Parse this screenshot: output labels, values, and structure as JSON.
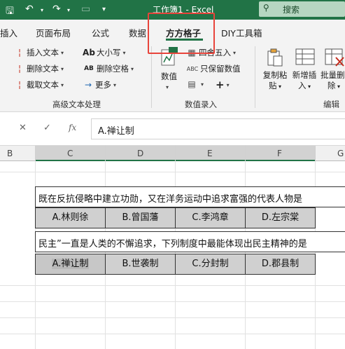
{
  "window": {
    "title": "工作簿1  -  Excel",
    "search_label": "搜索"
  },
  "tabs": [
    "插入",
    "页面布局",
    "公式",
    "数据",
    "方方格子",
    "DIY工具箱"
  ],
  "ribbon": {
    "text_group": {
      "items": [
        "插入文本",
        "删除文本",
        "截取文本"
      ],
      "items_right": [
        "大小写",
        "删除空格",
        "更多"
      ],
      "label": "高级文本处理"
    },
    "number_group": {
      "big_button": "数值",
      "items": [
        "四舍五入",
        "只保留数值"
      ],
      "label": "数值录入"
    },
    "edit_group": {
      "buttons": [
        {
          "line1": "复制粘",
          "line2": "贴"
        },
        {
          "line1": "新增插",
          "line2": "入"
        },
        {
          "line1": "批量删",
          "line2": "除"
        }
      ],
      "label": "编辑"
    }
  },
  "formula_bar": {
    "fx": "fx",
    "value": "A.禅让制"
  },
  "columns": [
    "B",
    "C",
    "D",
    "E",
    "F",
    "G"
  ],
  "questions": [
    {
      "text": "既在反抗侵略中建立功勋，又在洋务运动中追求富强的代表人物是",
      "options": [
        "A.林则徐",
        "B.曾国藩",
        "C.李鸿章",
        "D.左宗棠"
      ]
    },
    {
      "text": "民主”一直是人类的不懈追求，下列制度中最能体现出民主精神的是",
      "options": [
        "A.禅让制",
        "B.世袭制",
        "C.分封制",
        "D.郡县制"
      ]
    }
  ]
}
